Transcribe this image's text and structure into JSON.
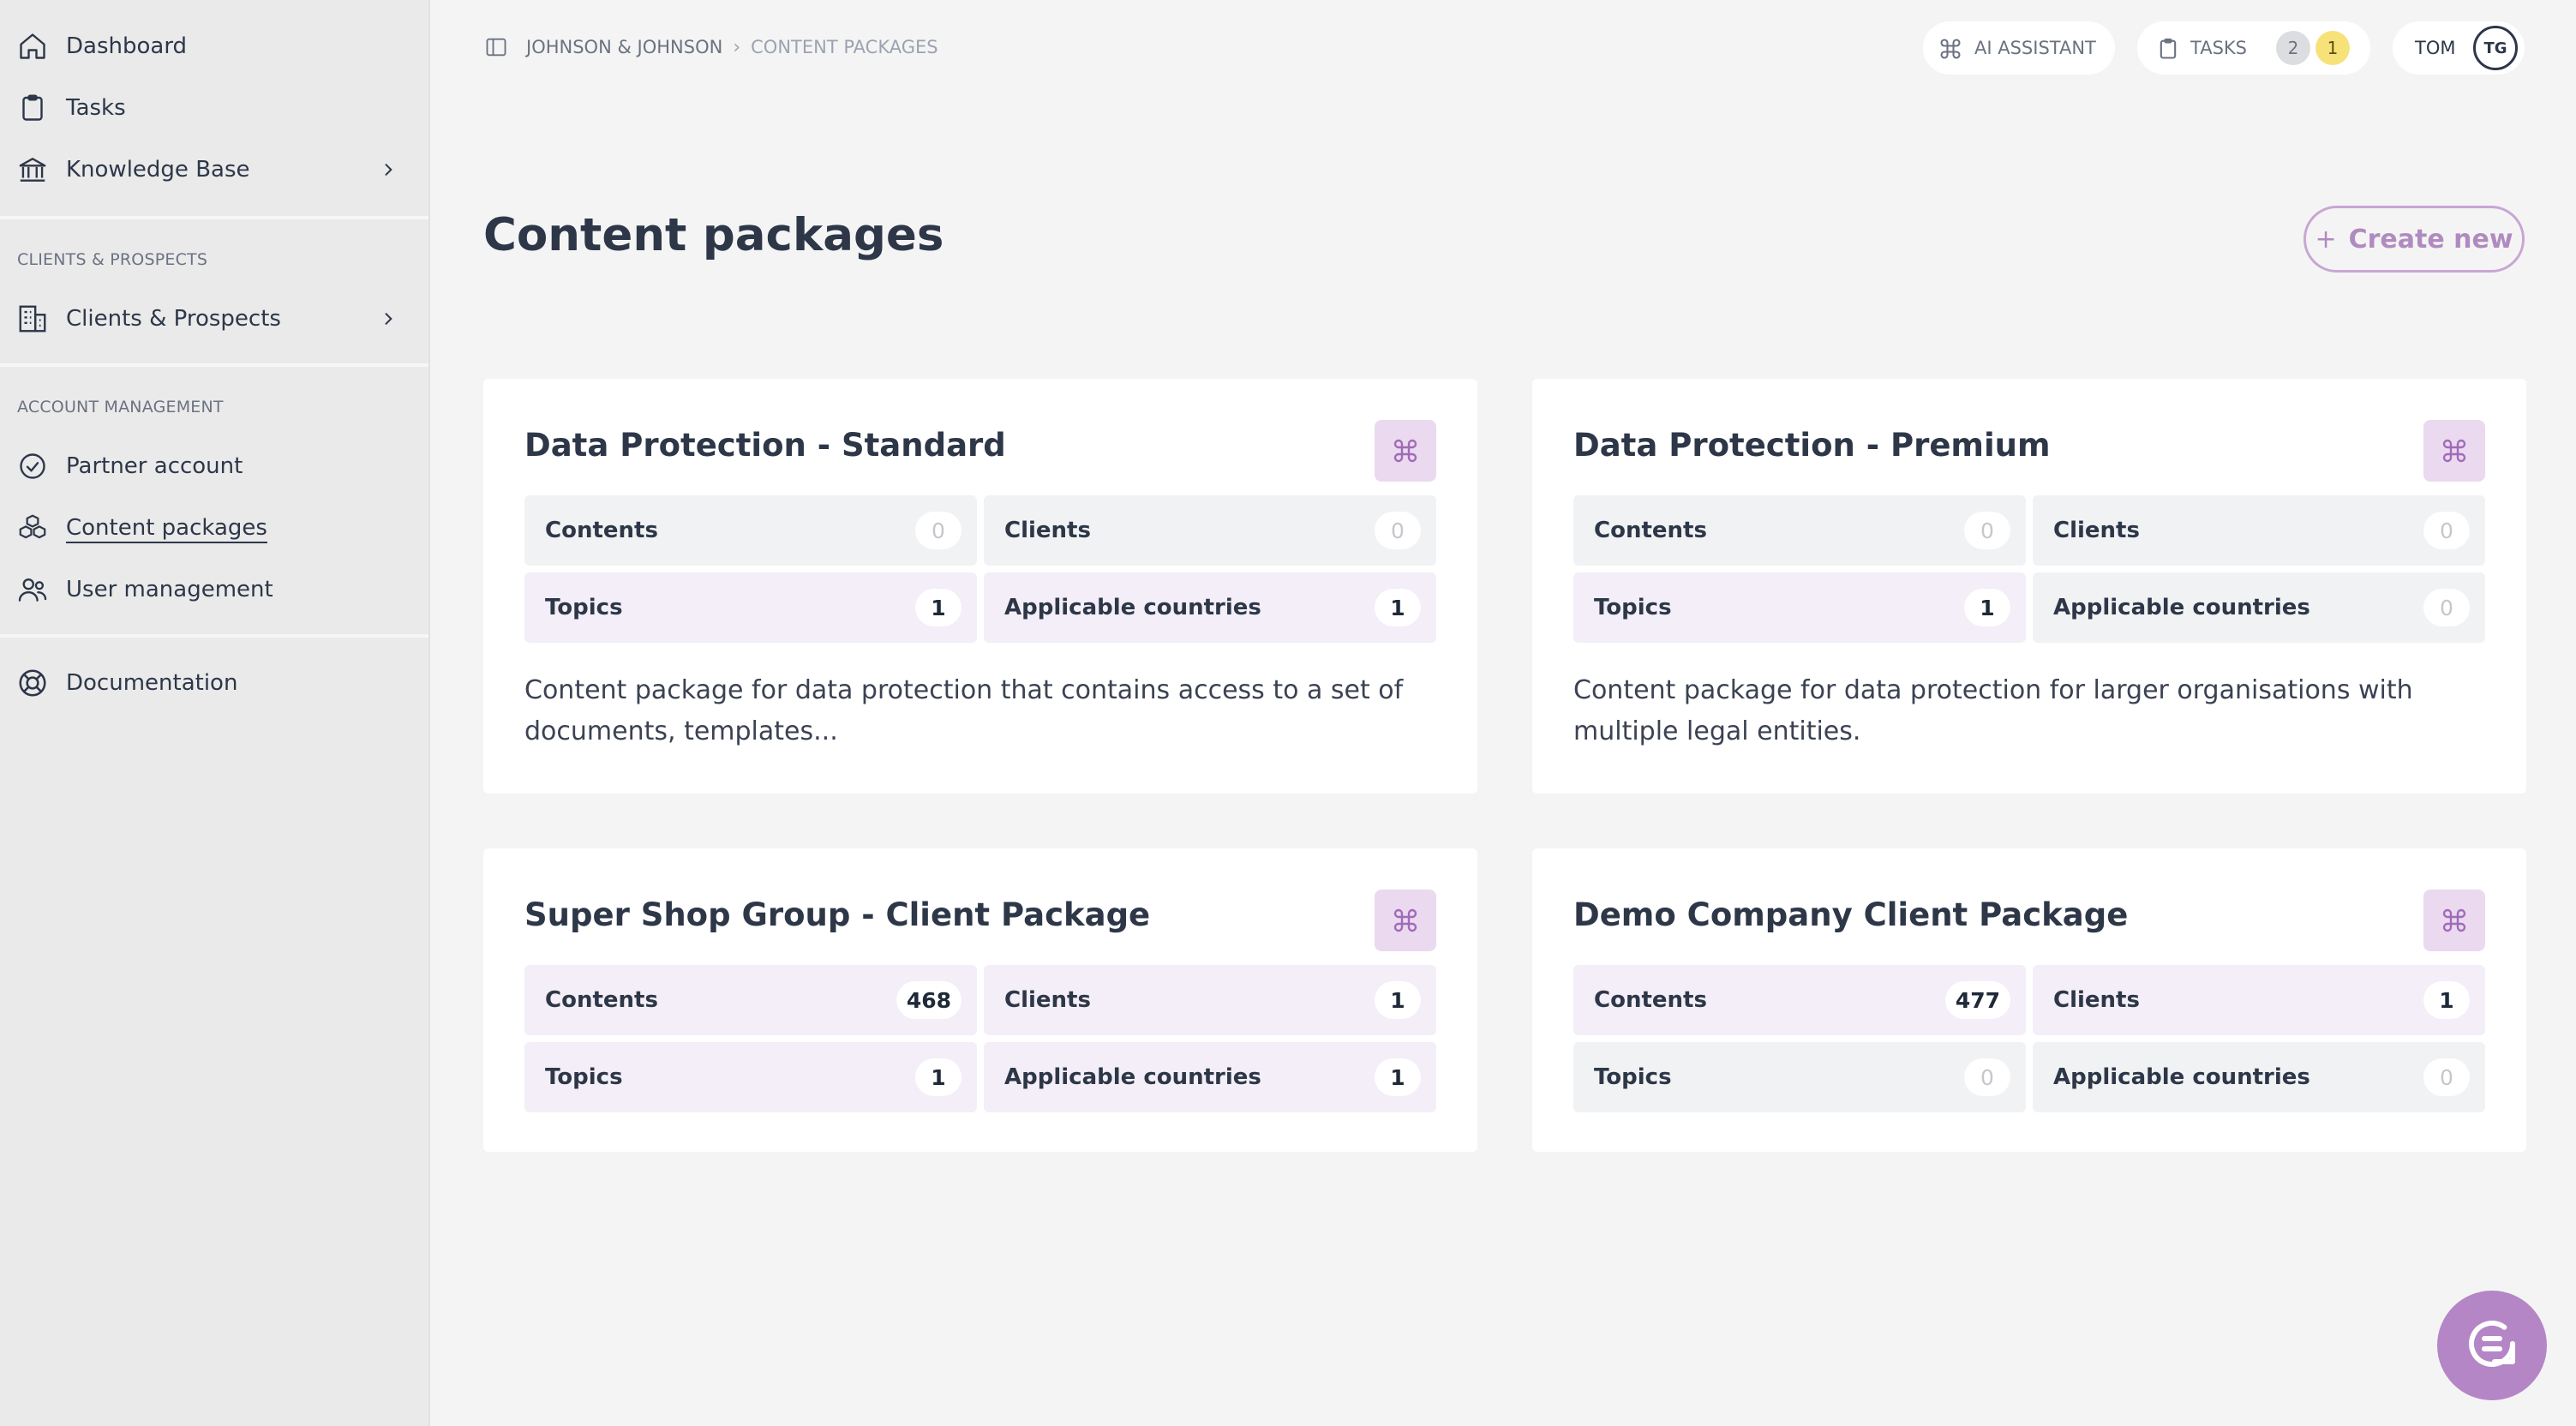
{
  "sidebar": {
    "items": [
      {
        "label": "Dashboard",
        "icon": "home-icon"
      },
      {
        "label": "Tasks",
        "icon": "clipboard-icon"
      },
      {
        "label": "Knowledge Base",
        "icon": "bank-icon"
      }
    ],
    "section_clients": "CLIENTS & PROSPECTS",
    "clients_item": {
      "label": "Clients & Prospects",
      "icon": "building-icon"
    },
    "section_account": "ACCOUNT MANAGEMENT",
    "account_items": [
      {
        "label": "Partner account",
        "icon": "check-circle-icon"
      },
      {
        "label": "Content packages",
        "icon": "cubes-icon",
        "active": true
      },
      {
        "label": "User management",
        "icon": "users-icon"
      }
    ],
    "documentation": {
      "label": "Documentation",
      "icon": "lifebuoy-icon"
    }
  },
  "header": {
    "breadcrumb": {
      "org": "JOHNSON & JOHNSON",
      "sep": "›",
      "page": "CONTENT PACKAGES"
    },
    "ai_assistant": "AI ASSISTANT",
    "tasks": {
      "label": "TASKS",
      "count_gray": "2",
      "count_yellow": "1"
    },
    "user": {
      "name": "TOM",
      "initials": "TG"
    }
  },
  "main": {
    "title": "Content packages",
    "create_label": "Create new",
    "create_icon": "+",
    "cards": [
      {
        "title": "Data Protection - Standard",
        "stats": {
          "contents": {
            "label": "Contents",
            "value": "0"
          },
          "clients": {
            "label": "Clients",
            "value": "0"
          },
          "topics": {
            "label": "Topics",
            "value": "1"
          },
          "countries": {
            "label": "Applicable countries",
            "value": "1"
          }
        },
        "description": "Content package for data protection that contains access to a set of documents, templates..."
      },
      {
        "title": "Data Protection - Premium",
        "stats": {
          "contents": {
            "label": "Contents",
            "value": "0"
          },
          "clients": {
            "label": "Clients",
            "value": "0"
          },
          "topics": {
            "label": "Topics",
            "value": "1"
          },
          "countries": {
            "label": "Applicable countries",
            "value": "0"
          }
        },
        "description": "Content package for data protection for larger organisations with multiple legal entities."
      },
      {
        "title": "Super Shop Group - Client Package",
        "stats": {
          "contents": {
            "label": "Contents",
            "value": "468"
          },
          "clients": {
            "label": "Clients",
            "value": "1"
          },
          "topics": {
            "label": "Topics",
            "value": "1"
          },
          "countries": {
            "label": "Applicable countries",
            "value": "1"
          }
        },
        "description": ""
      },
      {
        "title": "Demo Company Client Package",
        "stats": {
          "contents": {
            "label": "Contents",
            "value": "477"
          },
          "clients": {
            "label": "Clients",
            "value": "1"
          },
          "topics": {
            "label": "Topics",
            "value": "0"
          },
          "countries": {
            "label": "Applicable countries",
            "value": "0"
          }
        },
        "description": ""
      }
    ]
  },
  "colors": {
    "accent": "#b486c6",
    "accent_light": "#ead9ef",
    "highlight": "#f3eef7",
    "text": "#2d3748",
    "badge_yellow": "#f7e27a",
    "badge_gray": "#dcdde0"
  }
}
